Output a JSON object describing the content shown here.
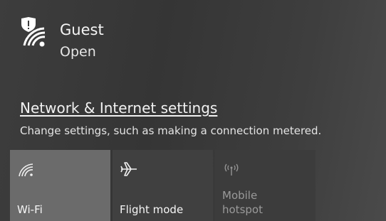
{
  "network": {
    "name": "Guest",
    "status": "Open",
    "icon": "wifi-secure-icon"
  },
  "settings": {
    "link_label": "Network & Internet settings",
    "description": "Change settings, such as making a connection metered."
  },
  "quick_actions": [
    {
      "label": "Wi-Fi",
      "icon": "wifi-icon",
      "state": "on"
    },
    {
      "label": "Flight mode",
      "icon": "airplane-icon",
      "state": "off"
    },
    {
      "label": "Mobile hotspot",
      "icon": "hotspot-icon",
      "state": "disabled"
    }
  ],
  "colors": {
    "panel_background": "#3a3a3a",
    "tile_active": "#6b6b6b",
    "tile_inactive": "#404040",
    "text": "#ffffff",
    "disabled_text": "#9a9a9a"
  }
}
